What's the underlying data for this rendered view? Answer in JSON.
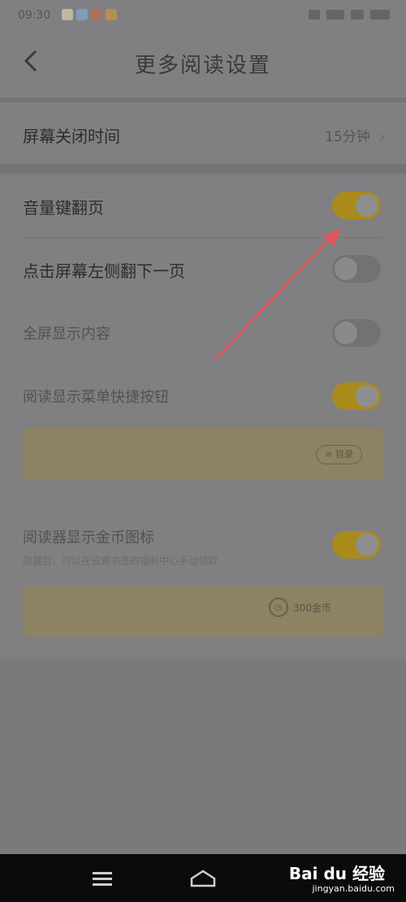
{
  "status_bar": {
    "time": "09:30",
    "app_icon_colors": [
      "#c9c9a8",
      "#7fa3c7",
      "#b76b4a",
      "#c29148"
    ]
  },
  "nav": {
    "title": "更多阅读设置",
    "back_icon": "chevron-left-icon"
  },
  "screen_off": {
    "label": "屏幕关闭时间",
    "value": "15分钟",
    "chevron": "›"
  },
  "settings": [
    {
      "label": "音量键翻页",
      "on": true
    },
    {
      "label": "点击屏幕左侧翻下一页",
      "on": false
    },
    {
      "label": "全屏显示内容",
      "on": false
    },
    {
      "label": "阅读显示菜单快捷按钮",
      "on": true
    }
  ],
  "menu_preview": {
    "pill_text": "≡ 目录"
  },
  "coin_setting": {
    "label": "阅读器显示金币图标",
    "subtext": "隐藏后，可以在设置书签的福利中心手动领取",
    "on": true
  },
  "coin_preview": {
    "pill_text": "300金币"
  },
  "colors": {
    "toggle_on": "#a98a1b",
    "arrow": "#e0555a"
  },
  "watermark": {
    "brand": "Bai du 经验",
    "url": "jingyan.baidu.com"
  }
}
